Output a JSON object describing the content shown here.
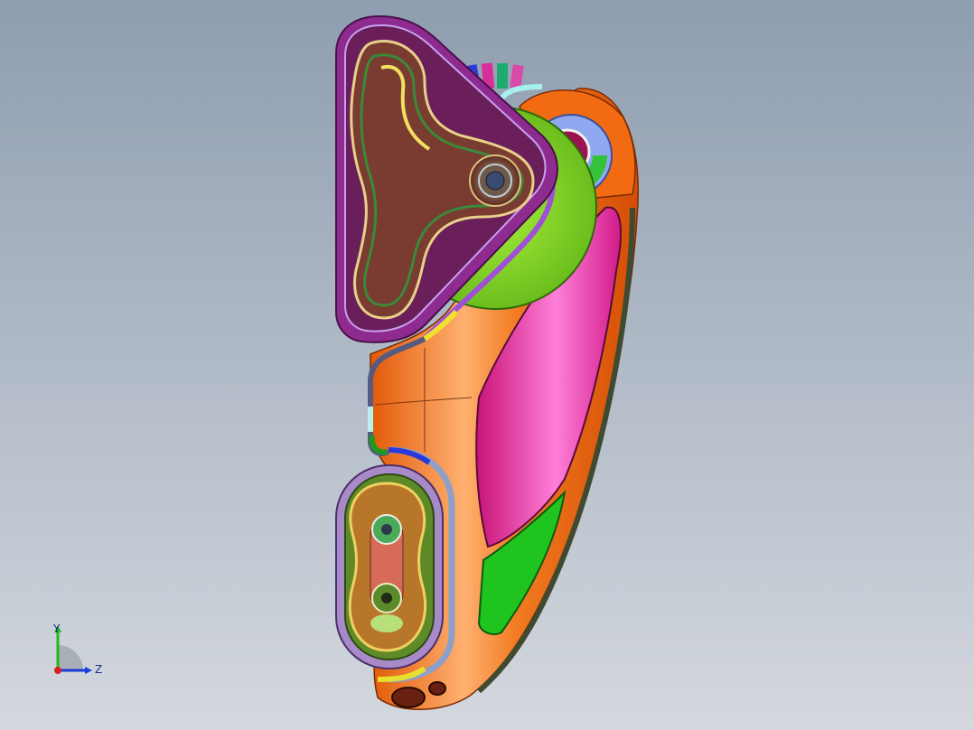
{
  "viewport": {
    "background_top": "#8e9db0",
    "background_bottom": "#d4d8de"
  },
  "triad": {
    "y_label": "Y",
    "z_label": "Z",
    "y_color": "#1fb81f",
    "z_color": "#1a3adb",
    "x_color": "#d81f1f"
  },
  "model": {
    "palette": {
      "body_orange": "#f06a10",
      "panel_pink": "#e8259a",
      "plate_purple": "#8e2b8f",
      "disc_green": "#7fd321",
      "lower_green": "#20c020",
      "bushing_blue": "#8fa8f0",
      "hub_brown": "#7a3b30"
    }
  }
}
